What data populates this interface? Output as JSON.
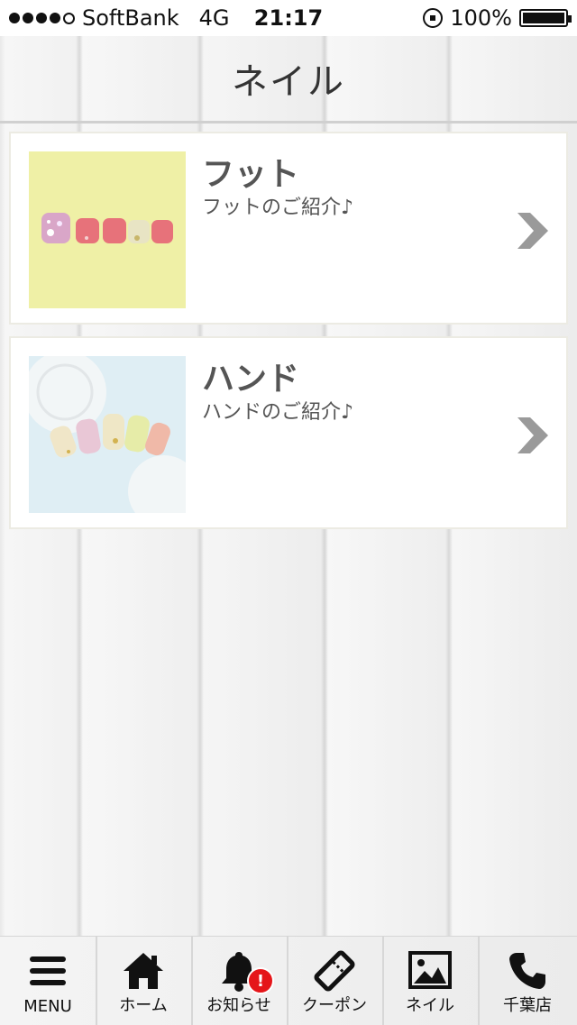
{
  "status_bar": {
    "carrier": "SoftBank",
    "network": "4G",
    "time": "21:17",
    "battery_percent": "100%",
    "signal_bars_filled": 4,
    "signal_bars_total": 5
  },
  "header": {
    "title": "ネイル"
  },
  "items": [
    {
      "title": "フット",
      "subtitle": "フットのご紹介♪",
      "image": "foot-nail-photo",
      "chevron_icon": "chevron-right-icon"
    },
    {
      "title": "ハンド",
      "subtitle": "ハンドのご紹介♪",
      "image": "hand-nail-photo",
      "chevron_icon": "chevron-right-icon"
    }
  ],
  "tab_bar": {
    "tabs": [
      {
        "label": "MENU",
        "icon": "menu-icon"
      },
      {
        "label": "ホーム",
        "icon": "home-icon"
      },
      {
        "label": "お知らせ",
        "icon": "bell-icon",
        "badge": "!"
      },
      {
        "label": "クーポン",
        "icon": "ticket-icon"
      },
      {
        "label": "ネイル",
        "icon": "image-icon"
      },
      {
        "label": "千葉店",
        "icon": "phone-icon"
      }
    ]
  },
  "colors": {
    "badge": "#e5161a",
    "text": "#555555",
    "chevron": "#9a9a9a"
  }
}
